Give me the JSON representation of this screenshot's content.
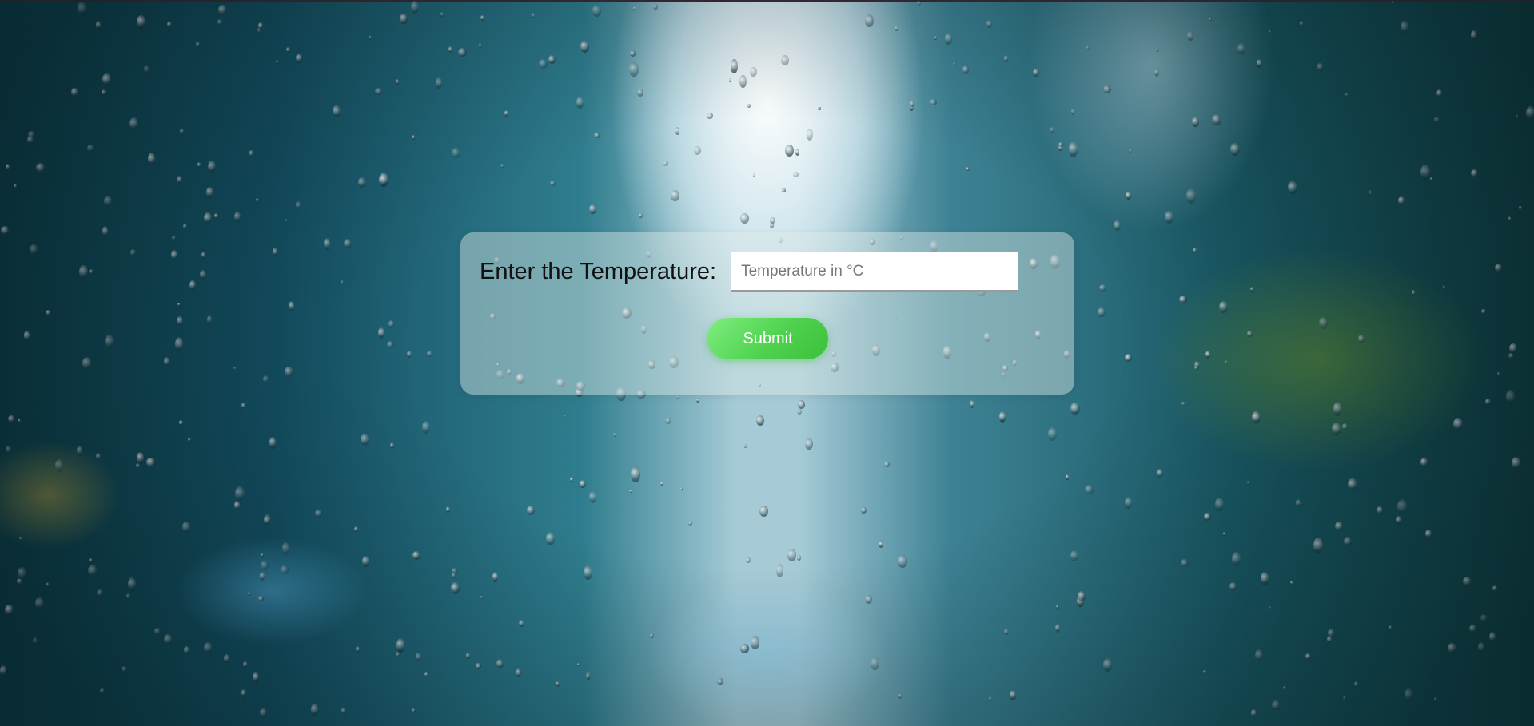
{
  "form": {
    "label": "Enter the Temperature:",
    "input_value": "",
    "input_placeholder": "Temperature in °C",
    "submit_label": "Submit"
  },
  "colors": {
    "button": "#4fd24f",
    "button_text": "#ffffff",
    "card": "rgba(220,232,230,0.45)",
    "label_text": "#111111"
  }
}
